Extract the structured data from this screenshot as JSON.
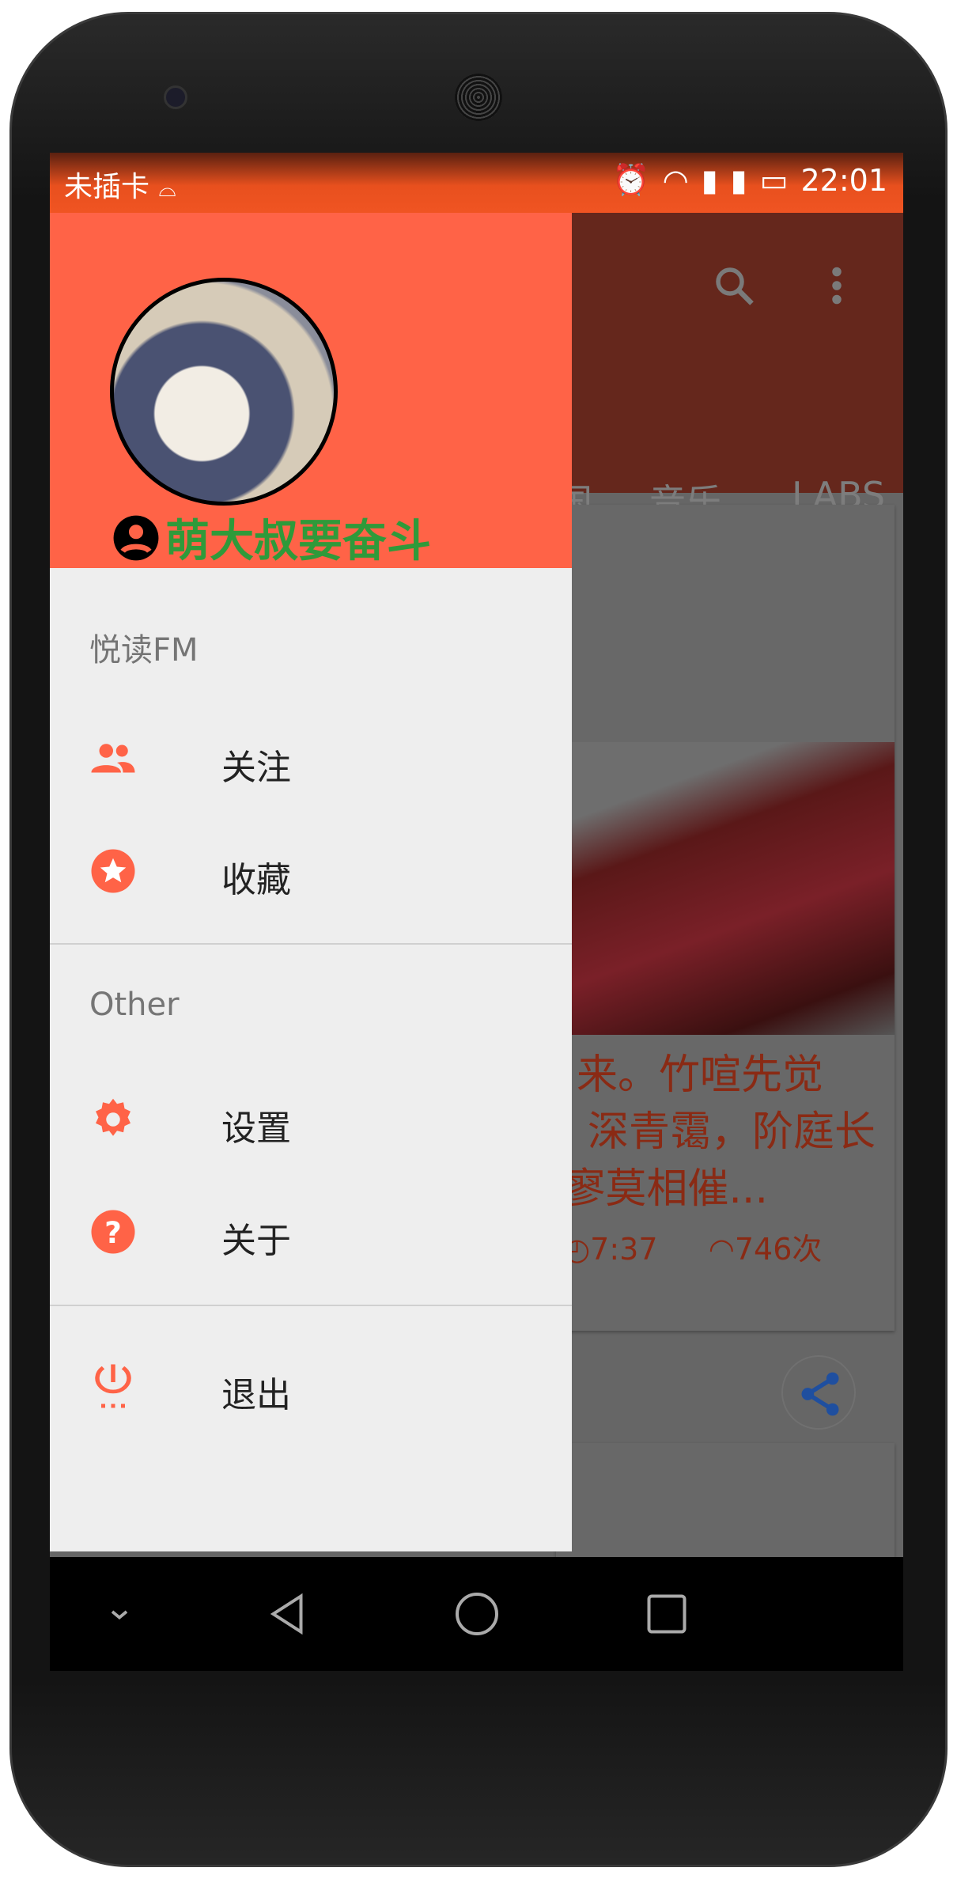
{
  "status_bar": {
    "carrier": "未插卡",
    "time": "22:01",
    "icons": [
      "android-icon",
      "alarm-icon",
      "wifi-icon",
      "sim-alert-icon",
      "sim-alert-icon",
      "battery-charging-icon"
    ]
  },
  "toolbar": {
    "icons": [
      "search-icon",
      "more-vert-icon"
    ],
    "tabs": [
      "国",
      "音乐",
      "LABS"
    ]
  },
  "content": {
    "card": {
      "lines": [
        "来。竹喧先觉",
        "深青霭，阶庭长",
        "寥莫相催..."
      ],
      "duration": "7:37",
      "plays": "746次"
    },
    "share_icon": "share-icon"
  },
  "drawer": {
    "user_name": "萌大叔要奋斗",
    "sections": [
      {
        "title": "悦读FM",
        "items": [
          {
            "label": "关注",
            "icon": "people-icon"
          },
          {
            "label": "收藏",
            "icon": "star-icon"
          }
        ]
      },
      {
        "title": "Other",
        "items": [
          {
            "label": "设置",
            "icon": "gear-icon"
          },
          {
            "label": "关于",
            "icon": "help-icon"
          }
        ]
      },
      {
        "title": "",
        "items": [
          {
            "label": "退出",
            "icon": "power-icon"
          }
        ]
      }
    ]
  },
  "colors": {
    "accent": "#ff6347",
    "toolbar": "#65271c",
    "username": "#2f9a3a",
    "status": "#f05422"
  }
}
